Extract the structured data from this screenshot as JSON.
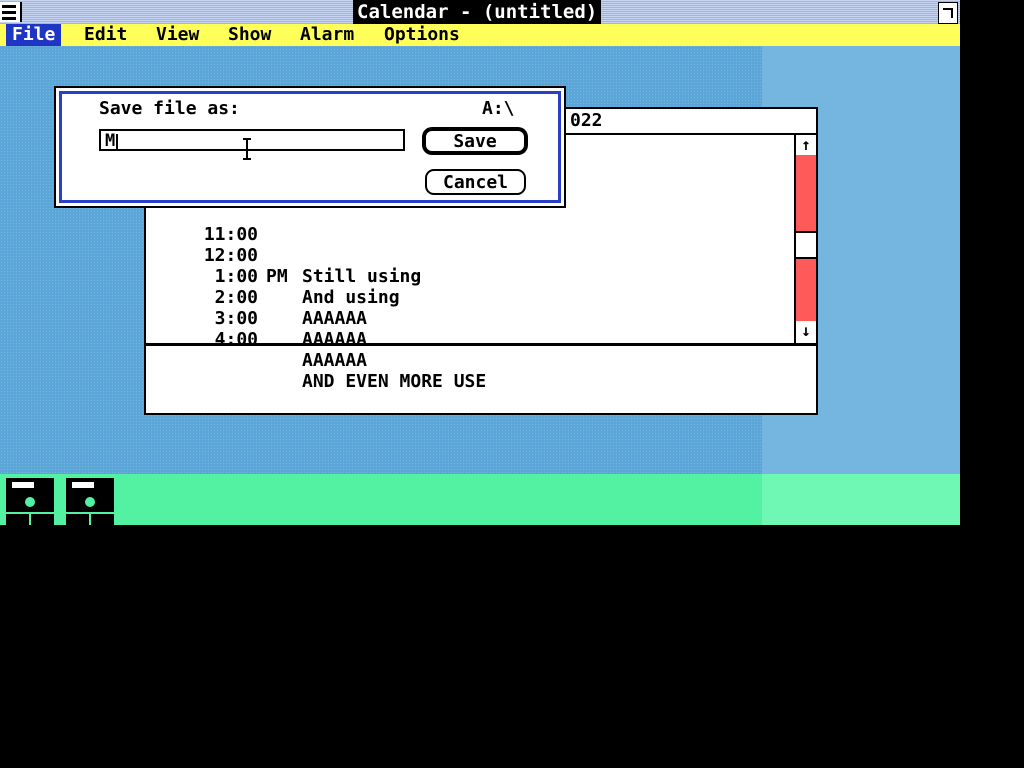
{
  "window": {
    "title": "Calendar - (untitled)"
  },
  "menu": [
    {
      "label": "File",
      "active": true
    },
    {
      "label": "Edit",
      "active": false
    },
    {
      "label": "View",
      "active": false
    },
    {
      "label": "Show",
      "active": false
    },
    {
      "label": "Alarm",
      "active": false
    },
    {
      "label": "Options",
      "active": false
    }
  ],
  "calendar": {
    "date_partial": "022",
    "entries": [
      {
        "time": "11:00",
        "ampm": "",
        "text": "Still using"
      },
      {
        "time": "12:00",
        "ampm": "PM",
        "text": "And using"
      },
      {
        "time": "1:00",
        "ampm": "",
        "text": "AAAAAA"
      },
      {
        "time": "2:00",
        "ampm": "",
        "text": "AAAAAA"
      },
      {
        "time": "3:00",
        "ampm": "",
        "text": "AAAAAA"
      },
      {
        "time": "4:00",
        "ampm": "",
        "text": "AND EVEN MORE USE"
      }
    ]
  },
  "dialog": {
    "label": "Save file as:",
    "directory": "A:\\",
    "filename_value": "M",
    "save_label": "Save",
    "cancel_label": "Cancel"
  },
  "icons": [
    "floppy-disk-icon",
    "floppy-disk-icon"
  ],
  "colors": {
    "desktop": "#5aa6d8",
    "menubar": "#ffff5a",
    "menu_active": "#1f36c4",
    "icon_area": "#52f2a2",
    "scrollbar": "#ff5a5a",
    "dialog_border": "#2a3fc9"
  }
}
